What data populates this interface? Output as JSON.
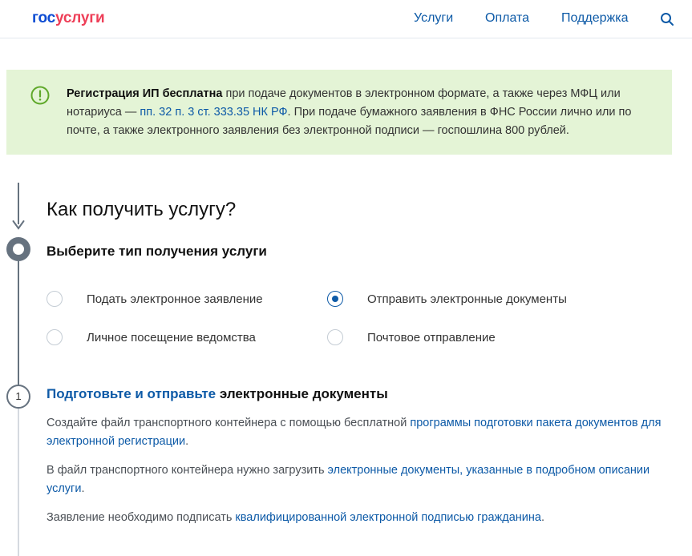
{
  "header": {
    "logo_part1": "гос",
    "logo_part2": "услуги",
    "nav": {
      "services": "Услуги",
      "payment": "Оплата",
      "support": "Поддержка"
    }
  },
  "notice": {
    "bold": "Регистрация ИП бесплатна",
    "text1": " при подаче документов в электронном формате, а также через МФЦ или нотариуса — ",
    "link": "пп. 32 п. 3 ст. 333.35 НК РФ",
    "text2": ". При подаче бумажного заявления в ФНС России лично или по почте, а также электронного заявления без электронной подписи — госпошлина 800 рублей."
  },
  "main": {
    "title": "Как получить услугу?",
    "subtitle": "Выберите тип получения услуги",
    "options": [
      {
        "label": "Подать электронное заявление",
        "checked": false
      },
      {
        "label": "Отправить электронные документы",
        "checked": true
      },
      {
        "label": "Личное посещение ведомства",
        "checked": false
      },
      {
        "label": "Почтовое отправление",
        "checked": false
      }
    ]
  },
  "step1": {
    "number": "1",
    "title_link": "Подготовьте и отправьте",
    "title_rest": " электронные документы",
    "p1_text": "Создайте файл транспортного контейнера с помощью бесплатной ",
    "p1_link": "программы подготовки пакета документов для электронной регистрации",
    "p1_end": ".",
    "p2_text": "В файл транспортного контейнера нужно загрузить ",
    "p2_link": "электронные документы, указанные в подробном описании услуги",
    "p2_end": ".",
    "p3_text": "Заявление необходимо подписать ",
    "p3_link": "квалифицированной электронной подписью гражданина",
    "p3_end": "."
  },
  "colors": {
    "brand_blue": "#0d4cd3",
    "brand_red": "#ee3f58",
    "link": "#0d5aa7",
    "notice_bg": "#e4f4d6",
    "notice_icon": "#5fa82a"
  }
}
